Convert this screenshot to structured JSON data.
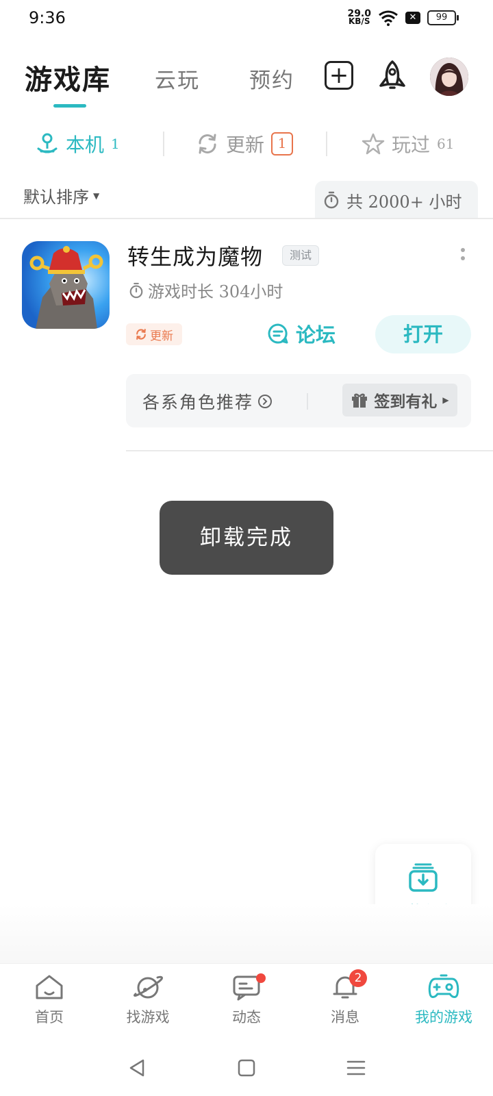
{
  "status_bar": {
    "time": "9:36",
    "net_speed_value": "29.0",
    "net_speed_unit": "KB/S",
    "battery": "99"
  },
  "header": {
    "tabs": [
      {
        "label": "游戏库",
        "active": true
      },
      {
        "label": "云玩",
        "active": false
      },
      {
        "label": "预约",
        "active": false
      }
    ]
  },
  "subtabs": {
    "local": {
      "label": "本机",
      "count": "1"
    },
    "update": {
      "label": "更新",
      "count": "1"
    },
    "played": {
      "label": "玩过",
      "count": "61"
    }
  },
  "sort": {
    "label": "默认排序",
    "total_hours": "共 2000+ 小时"
  },
  "game": {
    "title": "转生成为魔物",
    "badge": "测试",
    "playtime": "游戏时长 304小时",
    "update_tag": "更新",
    "forum_label": "论坛",
    "open_label": "打开",
    "extra_text": "各系角色推荐",
    "signin_label": "签到有礼"
  },
  "toast": {
    "text": "卸载完成"
  },
  "fab": {
    "label": "下载任务"
  },
  "bottom_nav": {
    "items": [
      {
        "label": "首页"
      },
      {
        "label": "找游戏"
      },
      {
        "label": "动态"
      },
      {
        "label": "消息",
        "badge": "2"
      },
      {
        "label": "我的游戏"
      }
    ]
  },
  "colors": {
    "accent": "#2bb9c1",
    "update_orange": "#e8744b",
    "badge_red": "#f0483e",
    "toast_bg": "#4b4b4b"
  }
}
